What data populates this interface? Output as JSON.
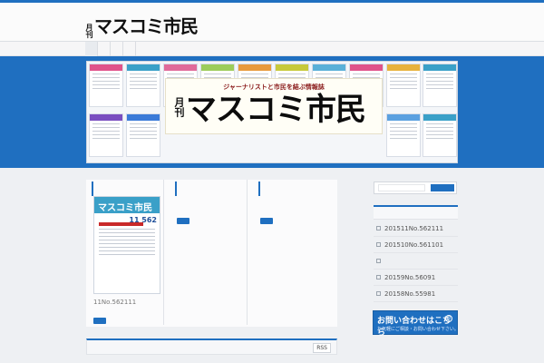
{
  "header": {
    "logo_prefix": "月刊",
    "logo_text": "マスコミ市民"
  },
  "banner": {
    "tagline": "ジャーナリストと市民を結ぶ情報誌",
    "title": "マスコミ市民",
    "title_prefix": "月刊"
  },
  "main": {
    "cover": {
      "masthead": "マスコミ市民",
      "issue": "11 562"
    },
    "caption": "11No.562111",
    "rss_label": "RSS"
  },
  "sidebar": {
    "items": [
      {
        "label": "201511No.562111"
      },
      {
        "label": "201510No.561101"
      },
      {
        "label": ""
      },
      {
        "label": "20159No.56091"
      },
      {
        "label": "20158No.55981"
      }
    ],
    "contact_title": "お問い合わせはこちら",
    "contact_icon": "⊙",
    "contact_sub": "お気軽にご相談・お問い合わせ下さい。"
  },
  "colors": {
    "accent": "#1f6fc0",
    "background": "#eef0f3"
  }
}
